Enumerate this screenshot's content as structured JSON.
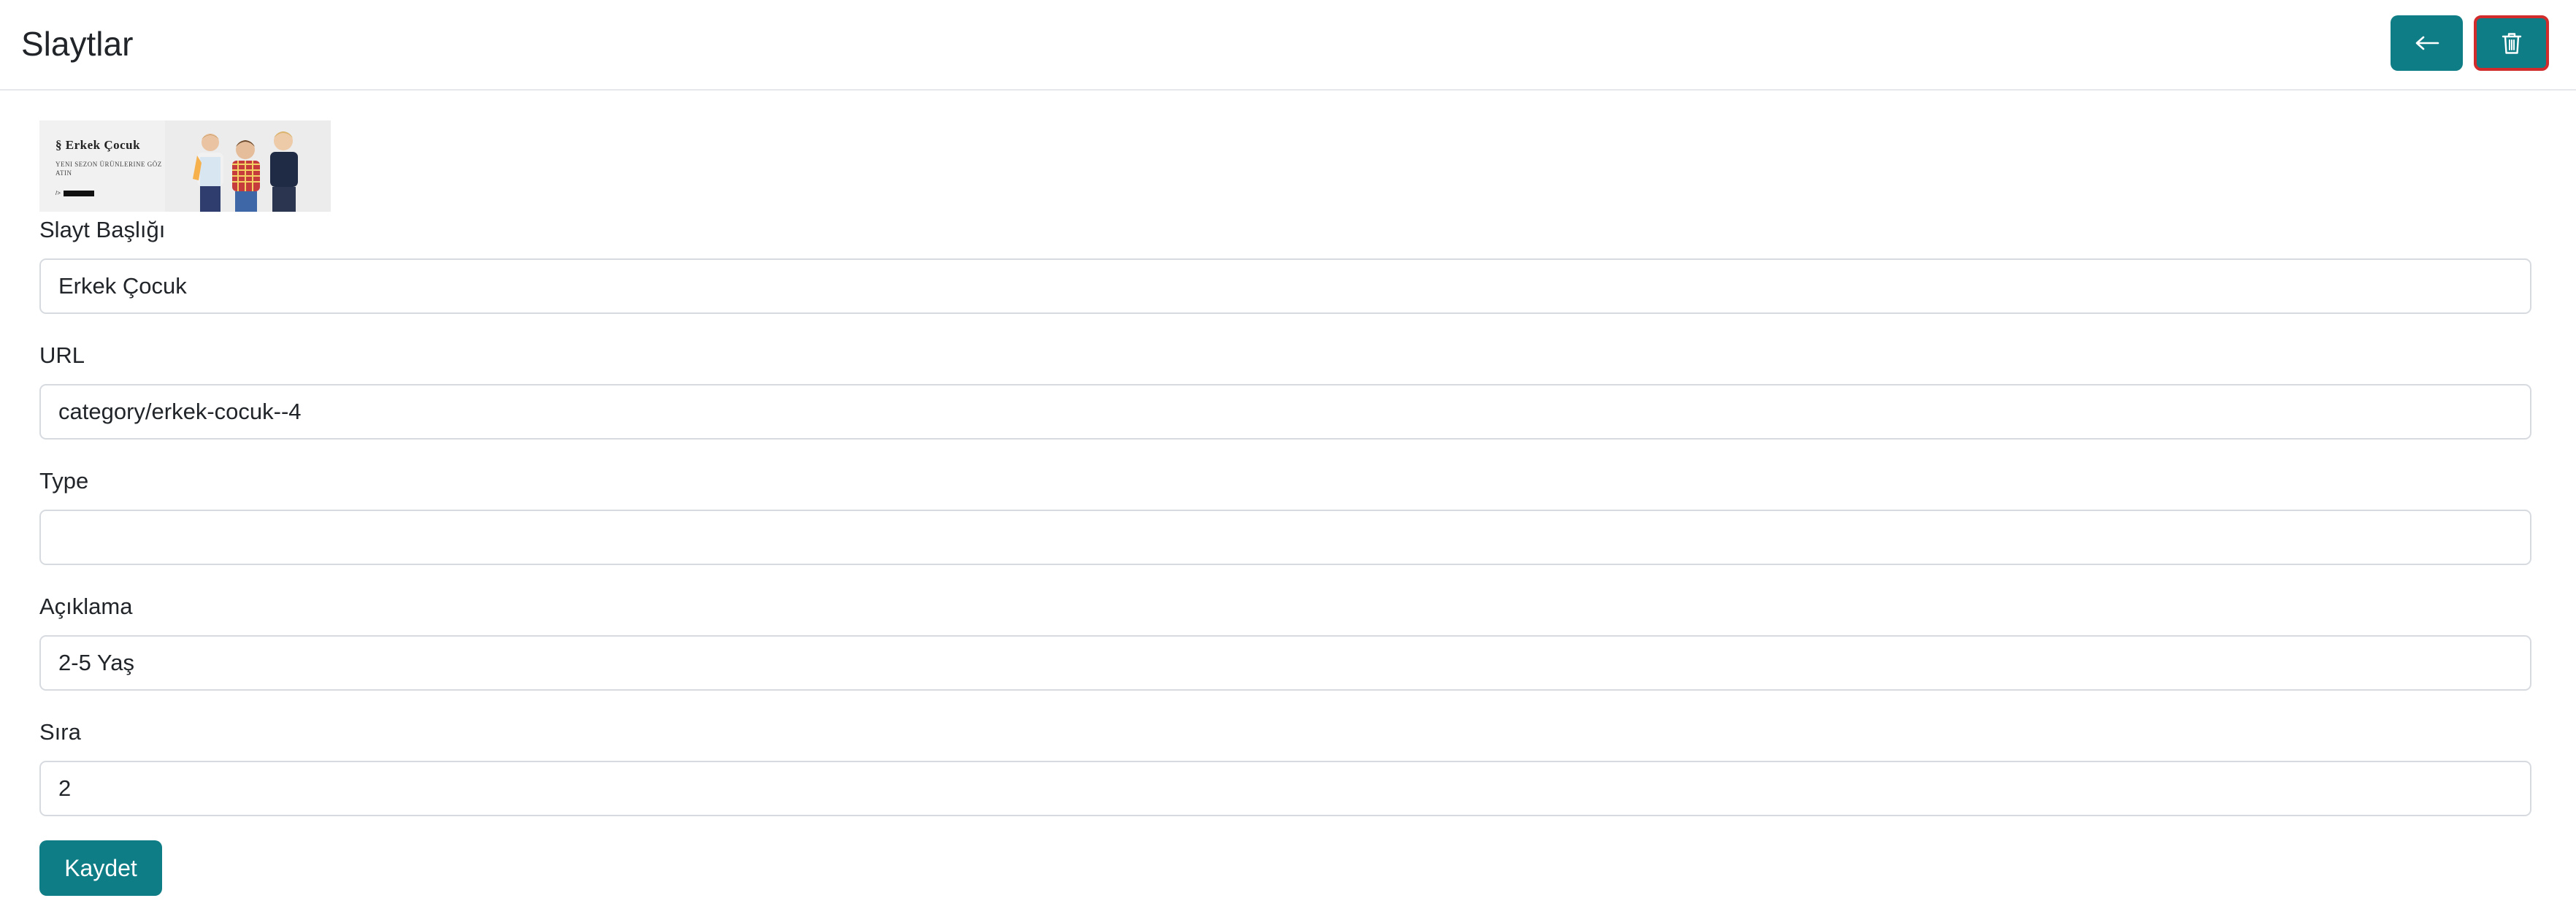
{
  "header": {
    "title": "Slaytlar",
    "back_icon": "arrow-left-icon",
    "delete_icon": "trash-icon",
    "accent_color": "#0f7d86",
    "delete_border_color": "#d12b2b"
  },
  "slide_image": {
    "brand": "Erkek Çocuk",
    "subtitle": "Yeni Sezon Ürünlerine Göz Atın",
    "cta_prefix": "/>"
  },
  "form": {
    "title_label": "Slayt Başlığı",
    "title_value": "Erkek Çocuk",
    "url_label": "URL",
    "url_value": "category/erkek-cocuk--4",
    "type_label": "Type",
    "type_value": "",
    "description_label": "Açıklama",
    "description_value": "2-5 Yaş",
    "order_label": "Sıra",
    "order_value": "2",
    "save_label": "Kaydet"
  }
}
